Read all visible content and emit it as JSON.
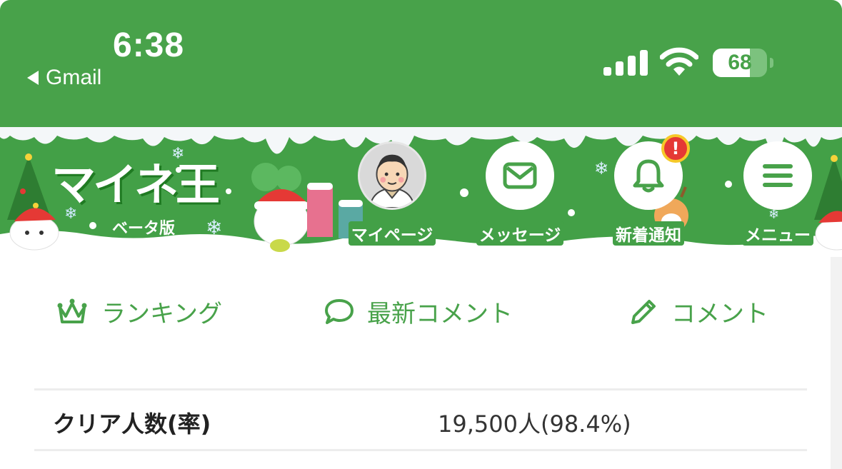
{
  "status_bar": {
    "time": "6:38",
    "back_label": "Gmail",
    "battery_level": "68",
    "battery_fraction": 0.68,
    "icons": [
      "back-triangle-icon",
      "cellular-signal-icon",
      "wifi-icon",
      "battery-icon"
    ]
  },
  "banner": {
    "logo": "マイネ王",
    "beta_label": "ベータ版",
    "nav": [
      {
        "label": "マイページ",
        "icon": "avatar"
      },
      {
        "label": "メッセージ",
        "icon": "mail-icon"
      },
      {
        "label": "新着通知",
        "icon": "bell-icon",
        "badge": "!"
      },
      {
        "label": "メニュー",
        "icon": "hamburger-icon"
      }
    ]
  },
  "tabs": [
    {
      "label": "ランキング",
      "icon": "crown-icon"
    },
    {
      "label": "最新コメント",
      "icon": "speech-bubble-icon"
    },
    {
      "label": "コメント",
      "icon": "pencil-icon"
    }
  ],
  "stats": {
    "clear_label": "クリア人数(率)",
    "clear_value": "19,500人(98.4%)"
  },
  "colors": {
    "brand_green": "#48a24a",
    "badge_red": "#e53935",
    "badge_ring": "#f6c928"
  }
}
